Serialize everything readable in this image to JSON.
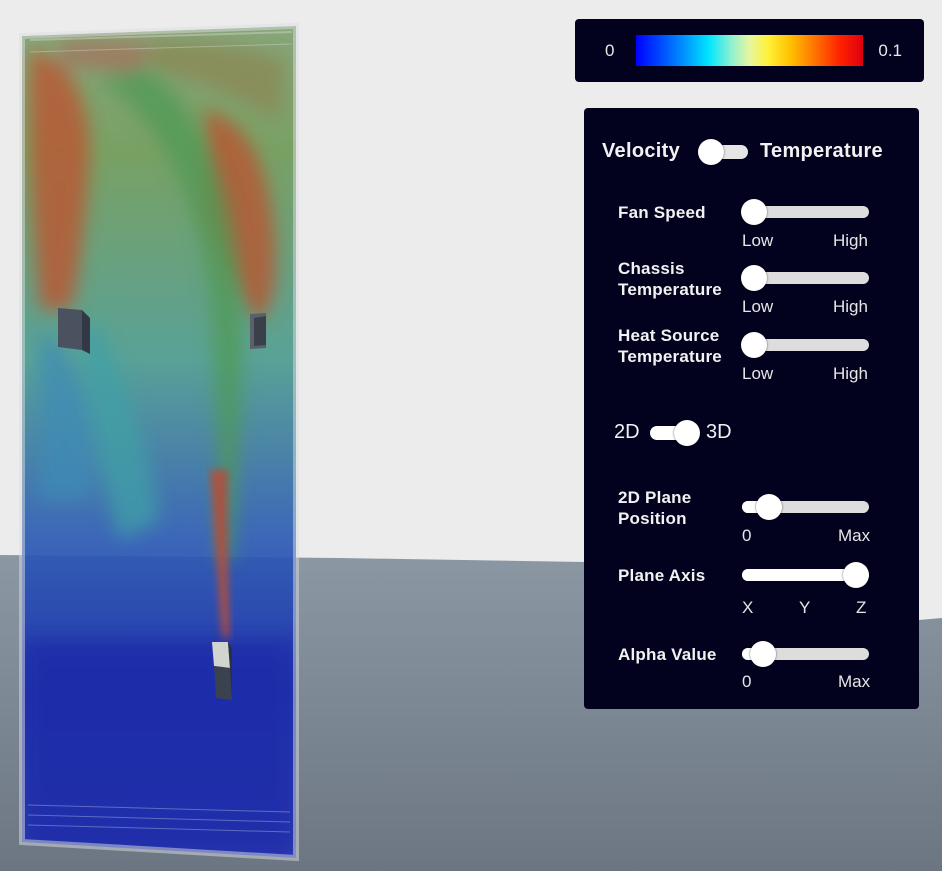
{
  "colorbar": {
    "min_label": "0",
    "max_label": "0.1"
  },
  "panel": {
    "mode_toggle": {
      "left_label": "Velocity",
      "right_label": "Temperature",
      "selected": "Velocity"
    },
    "fan_speed": {
      "label": "Fan Speed",
      "min_label": "Low",
      "max_label": "High",
      "value": 0
    },
    "chassis_temperature": {
      "label_line1": "Chassis",
      "label_line2": "Temperature",
      "min_label": "Low",
      "max_label": "High",
      "value": 0
    },
    "heat_source_temperature": {
      "label_line1": "Heat Source",
      "label_line2": "Temperature",
      "min_label": "Low",
      "max_label": "High",
      "value": 0
    },
    "dimension_toggle": {
      "left_label": "2D",
      "right_label": "3D",
      "selected": "3D"
    },
    "plane_position": {
      "label_line1": "2D Plane",
      "label_line2": "Position",
      "min_label": "0",
      "max_label": "Max",
      "value": 0.15
    },
    "plane_axis": {
      "label": "Plane Axis",
      "options": [
        "X",
        "Y",
        "Z"
      ],
      "selected": "Z"
    },
    "alpha_value": {
      "label": "Alpha Value",
      "min_label": "0",
      "max_label": "Max",
      "value": 0.1
    }
  },
  "colors": {
    "panel_bg": "#02021e",
    "background": "#ececec",
    "floor": "#7e8a96"
  }
}
